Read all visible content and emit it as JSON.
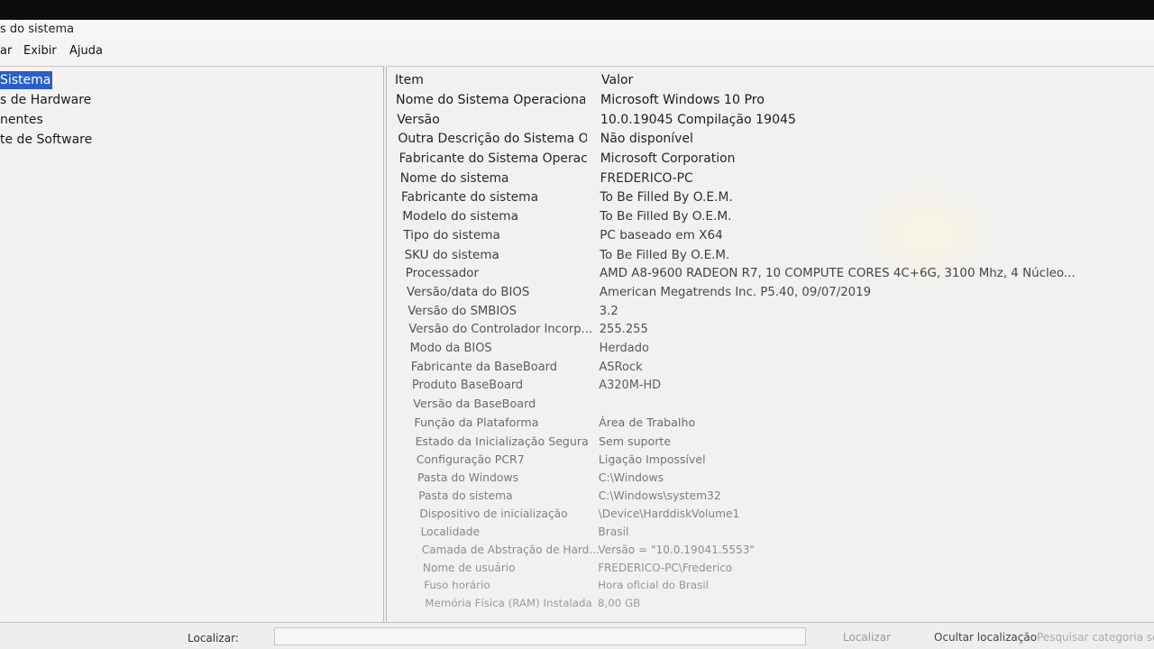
{
  "window": {
    "title": "s do sistema"
  },
  "menu": [
    {
      "label": "ar"
    },
    {
      "label": "Exibir"
    },
    {
      "label": "Ajuda"
    }
  ],
  "tree": [
    {
      "label": "Sistema",
      "selected": true
    },
    {
      "label": "s de Hardware",
      "selected": false
    },
    {
      "label": "nentes",
      "selected": false
    },
    {
      "label": "te de Software",
      "selected": false
    }
  ],
  "table": {
    "headers": {
      "item": "Item",
      "value": "Valor"
    },
    "rows": [
      {
        "item": "Nome do Sistema Operacional",
        "value": "Microsoft Windows 10 Pro"
      },
      {
        "item": "Versão",
        "value": "10.0.19045 Compilação 19045"
      },
      {
        "item": "Outra Descrição do Sistema O...",
        "value": "Não disponível"
      },
      {
        "item": "Fabricante do Sistema Operaci...",
        "value": "Microsoft Corporation"
      },
      {
        "item": "Nome do sistema",
        "value": "FREDERICO-PC"
      },
      {
        "item": "Fabricante do sistema",
        "value": "To Be Filled By O.E.M."
      },
      {
        "item": "Modelo do sistema",
        "value": "To Be Filled By O.E.M."
      },
      {
        "item": "Tipo do sistema",
        "value": "PC baseado em X64"
      },
      {
        "item": "SKU do sistema",
        "value": "To Be Filled By O.E.M."
      },
      {
        "item": "Processador",
        "value": "AMD A8-9600 RADEON R7, 10 COMPUTE CORES 4C+6G, 3100 Mhz, 4 Núcleo..."
      },
      {
        "item": "Versão/data do BIOS",
        "value": "American Megatrends Inc. P5.40, 09/07/2019"
      },
      {
        "item": "Versão do SMBIOS",
        "value": "3.2"
      },
      {
        "item": "Versão do Controlador Incorp...",
        "value": "255.255"
      },
      {
        "item": "Modo da BIOS",
        "value": "Herdado"
      },
      {
        "item": "Fabricante da BaseBoard",
        "value": "ASRock"
      },
      {
        "item": "Produto BaseBoard",
        "value": "A320M-HD"
      },
      {
        "item": "Versão da BaseBoard",
        "value": ""
      },
      {
        "item": "Função da Plataforma",
        "value": "Área de Trabalho"
      },
      {
        "item": "Estado da Inicialização Segura",
        "value": "Sem suporte"
      },
      {
        "item": "Configuração PCR7",
        "value": "Ligação Impossível"
      },
      {
        "item": "Pasta do Windows",
        "value": "C:\\Windows"
      },
      {
        "item": "Pasta do sistema",
        "value": "C:\\Windows\\system32"
      },
      {
        "item": "Dispositivo de inicialização",
        "value": "\\Device\\HarddiskVolume1"
      },
      {
        "item": "Localidade",
        "value": "Brasil"
      },
      {
        "item": "Camada de Abstração de Hard...",
        "value": "Versão = \"10.0.19041.5553\""
      },
      {
        "item": "Nome de usuário",
        "value": "FREDERICO-PC\\Frederico"
      },
      {
        "item": "Fuso horário",
        "value": "Hora oficial do Brasil"
      },
      {
        "item": "Memória Física (RAM) Instalada",
        "value": "8,00 GB"
      }
    ]
  },
  "statusbar": {
    "find_label": "Localizar:",
    "find_value": "",
    "find_button": "Localizar",
    "hide_find": "Ocultar localização",
    "search_selected": "Pesquisar categoria selecionada somente"
  }
}
